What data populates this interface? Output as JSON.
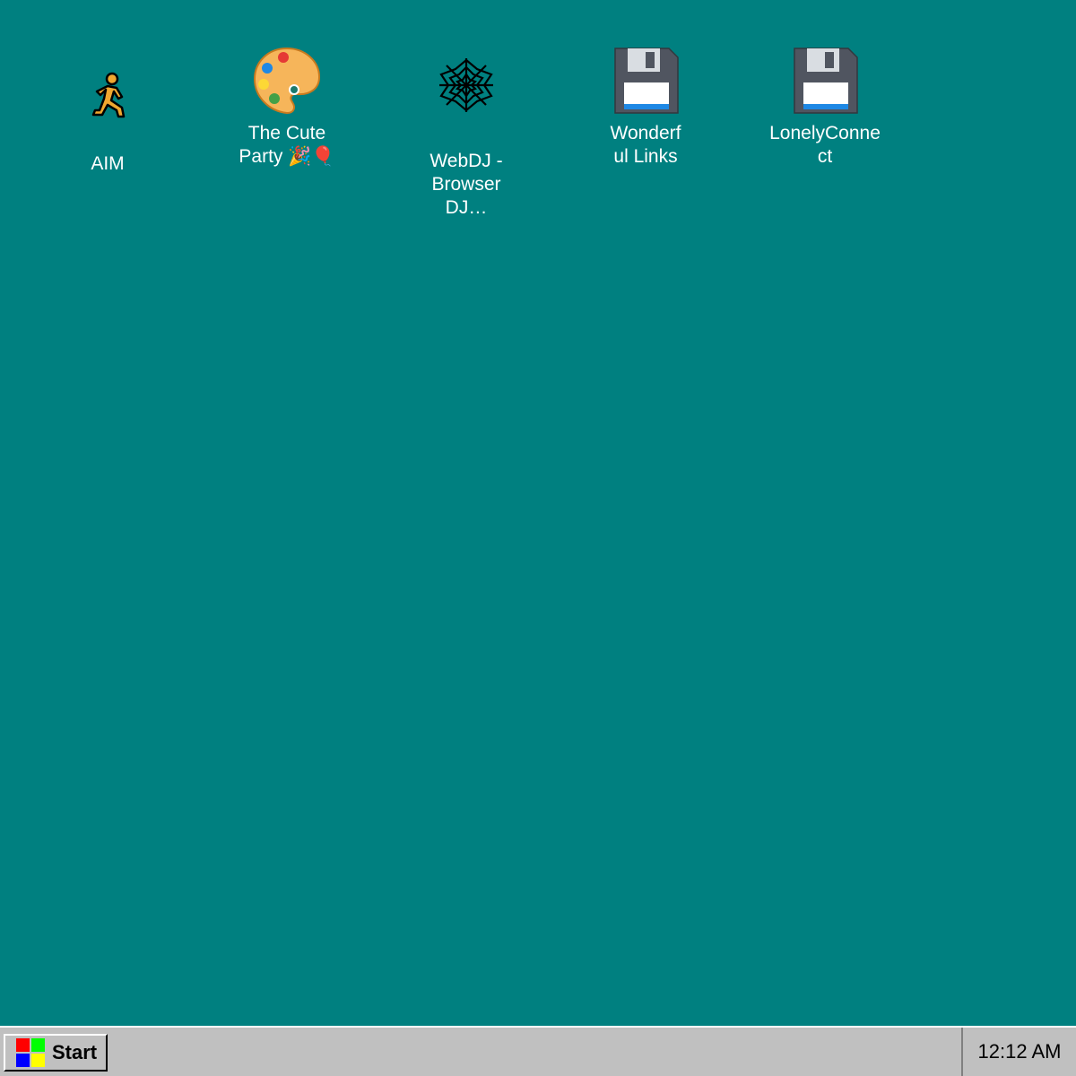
{
  "desktop": {
    "background": "#008080",
    "icons": [
      {
        "label": "AIM",
        "icon": "aim-running-man-icon"
      },
      {
        "label": "The Cute Party 🎉🎈",
        "icon": "paint-palette-icon"
      },
      {
        "label": "WebDJ - Browser DJ…",
        "icon": "spider-web-icon"
      },
      {
        "label": "Wonderful Links",
        "icon": "floppy-disk-icon"
      },
      {
        "label": "LonelyConnect",
        "icon": "floppy-disk-icon"
      }
    ]
  },
  "taskbar": {
    "start_label": "Start",
    "start_logo_colors": [
      "#ff0000",
      "#00ff00",
      "#0000ff",
      "#ffff00"
    ],
    "clock": "12:12 AM"
  }
}
